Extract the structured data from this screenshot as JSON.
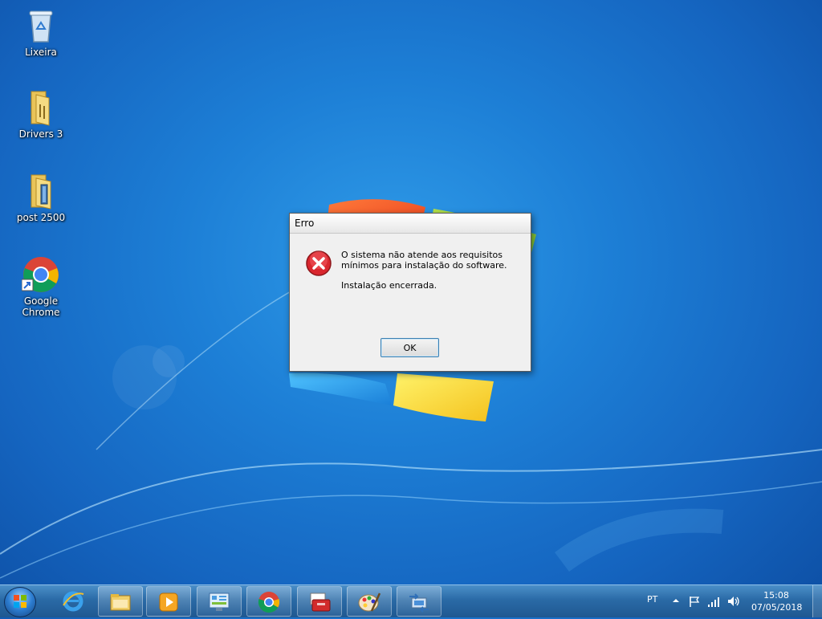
{
  "desktop": {
    "icons": [
      {
        "label": "Lixeira",
        "icon": "recycle-bin-icon"
      },
      {
        "label": "Drivers 3",
        "icon": "folder-icon"
      },
      {
        "label": "post 2500",
        "icon": "folder-icon"
      },
      {
        "label": "Google Chrome",
        "icon": "chrome-icon"
      }
    ]
  },
  "dialog": {
    "title": "Erro",
    "message_line1": "O sistema não atende aos requisitos mínimos para instalação do software.",
    "message_line2": "Instalação encerrada.",
    "ok_label": "OK",
    "icon": "error-icon"
  },
  "taskbar": {
    "pinned": [
      "internet-explorer-icon",
      "file-explorer-icon",
      "media-player-icon",
      "control-panel-icon",
      "chrome-icon",
      "toolbox-icon",
      "paint-icon",
      "network-icon"
    ],
    "tray": {
      "language": "PT",
      "time": "15:08",
      "date": "07/05/2018"
    }
  },
  "colors": {
    "desktop_blue": "#1d7fd6",
    "dialog_bg": "#f0f0f0",
    "error_red": "#d9262e"
  }
}
